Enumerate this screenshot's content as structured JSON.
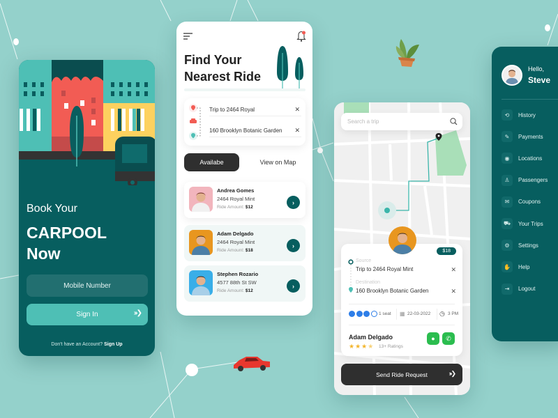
{
  "theme": {
    "bg": "#94d1cb",
    "teal_dark": "#075e5f",
    "teal_light": "#4ebfb5",
    "dark_button": "#2f2f2f",
    "red_accent": "#f25c54",
    "yellow_accent": "#fdd15f",
    "green_call": "#2bbd4f",
    "blue_seat": "#2e7ee8",
    "star": "#f3b52c"
  },
  "login_screen": {
    "title_line1": "Book Your",
    "title_line2": "CARPOOL",
    "title_line3": "Now",
    "mobile_placeholder": "Mobile Number",
    "sign_in_label": "Sign In",
    "sign_in_chevrons": "›››❯",
    "footer_text": "Don't have an Account?",
    "footer_link": "Sign Up"
  },
  "find_ride_screen": {
    "menu_icon": "☰",
    "title_line1": "Find Your",
    "title_line2": "Nearest Ride",
    "source": "Trip to 2464 Royal",
    "destination": "160 Brooklyn Botanic Garden",
    "clear_icon": "✕",
    "tab_available": "Availabe",
    "tab_map": "View on Map",
    "rides": [
      {
        "name": "Andrea Gomes",
        "address": "2464 Royal Mint",
        "amount_label": "Ride Amount:",
        "amount": "$12",
        "avatar_bg": "#f2b5bd",
        "shirt": "#f1f1f1",
        "hair": "#6b2a22"
      },
      {
        "name": "Adam Delgado",
        "address": "2464 Royal Mint",
        "amount_label": "Ride Amount:",
        "amount": "$18",
        "avatar_bg": "#e8961f",
        "shirt": "#4c7fa6",
        "hair": "#3b2a1e"
      },
      {
        "name": "Stephen Rozario",
        "address": "4577 88th St SW",
        "amount_label": "Ride Amount:",
        "amount": "$12",
        "avatar_bg": "#39aee8",
        "shirt": "#a8cfe8",
        "hair": "#2b2018"
      }
    ],
    "chevron": "›"
  },
  "map_screen": {
    "search_placeholder": "Search a trip",
    "price": "$18",
    "source_label": "Source",
    "source": "Trip to 2464 Royal Mint",
    "destination_label": "Destination",
    "destination": "160 Brooklyn Botanic Garden",
    "seats_total": 4,
    "seats_taken": 3,
    "seat_text": "1 seat",
    "date": "22-03-2022",
    "time": "3 PM",
    "driver_name": "Adam Delgado",
    "rating_stars": 4,
    "ratings_text": "13+ Ratings",
    "send_label": "Send Ride Request",
    "send_chevrons": "›››❯"
  },
  "menu_screen": {
    "greeting": "Hello,",
    "user_name": "Steve",
    "items": [
      {
        "label": "History",
        "icon": "history-icon",
        "glyph": "⟲"
      },
      {
        "label": "Payments",
        "icon": "payments-icon",
        "glyph": "✎"
      },
      {
        "label": "Locations",
        "icon": "location-icon",
        "glyph": "◉"
      },
      {
        "label": "Passengers",
        "icon": "passenger-icon",
        "glyph": "♙"
      },
      {
        "label": "Coupons",
        "icon": "coupon-icon",
        "glyph": "✉"
      },
      {
        "label": "Your Trips",
        "icon": "car-icon",
        "glyph": "⛟"
      },
      {
        "label": "Settings",
        "icon": "settings-icon",
        "glyph": "⚙"
      },
      {
        "label": "Help",
        "icon": "help-icon",
        "glyph": "✋"
      },
      {
        "label": "Logout",
        "icon": "logout-icon",
        "glyph": "⇥"
      }
    ]
  }
}
